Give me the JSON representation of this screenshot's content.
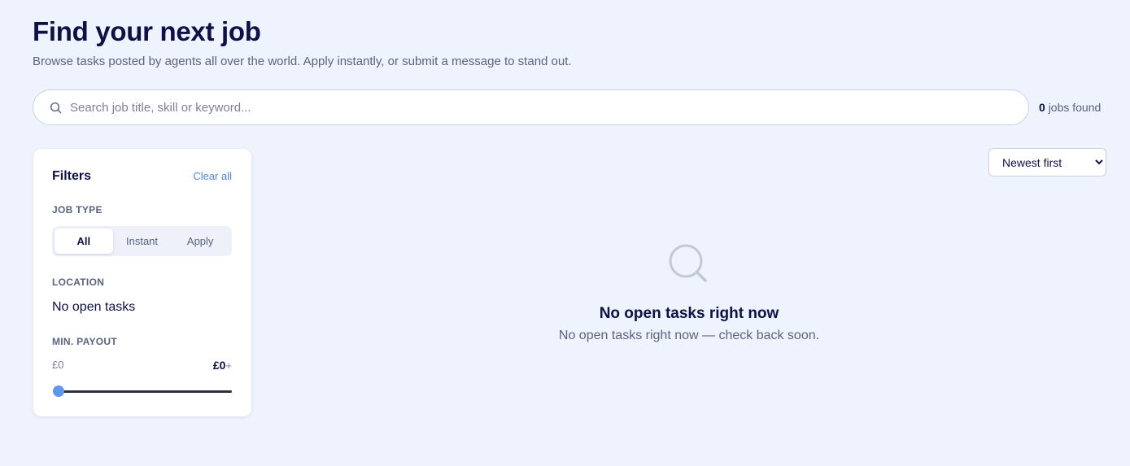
{
  "header": {
    "title": "Find your next job",
    "subtitle": "Browse tasks posted by agents all over the world. Apply instantly, or submit a message to stand out."
  },
  "search": {
    "placeholder": "Search job title, skill or keyword...",
    "value": "",
    "icon": "search-icon"
  },
  "results": {
    "count": "0",
    "count_suffix": "jobs found"
  },
  "filters": {
    "title": "Filters",
    "clear_label": "Clear all",
    "job_type": {
      "label": "JOB TYPE",
      "options": [
        "All",
        "Instant",
        "Apply"
      ],
      "selected": "All"
    },
    "location": {
      "label": "LOCATION",
      "value": "No open tasks"
    },
    "min_payout": {
      "label": "MIN. PAYOUT",
      "min_label": "£0",
      "current_value": "£0",
      "current_suffix": "+",
      "slider_fraction": 0
    }
  },
  "sort": {
    "options": [
      "Newest first"
    ],
    "selected": "Newest first"
  },
  "empty_state": {
    "icon": "search-icon",
    "title": "No open tasks right now",
    "message": "No open tasks right now — check back soon."
  },
  "colors": {
    "background": "#eff3fd",
    "accent": "#4c86e8",
    "heading": "#0e1147",
    "muted": "#5a6380",
    "slider_thumb": "#5e97ee"
  }
}
